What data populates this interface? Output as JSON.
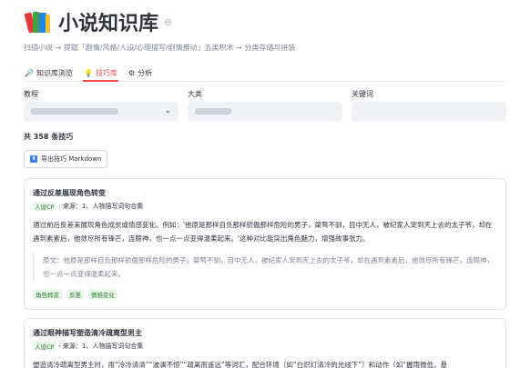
{
  "header": {
    "title": "小说知识库",
    "icon": "books-icon",
    "subtitle": "扫描小说 → 提取「剧情/风格/人设/心理描写/剧情推动」五类积木 → 分类存储与拼装"
  },
  "tabs": [
    {
      "label": "知识库浏览",
      "icon": "magnifier-icon",
      "active": false
    },
    {
      "label": "技巧库",
      "icon": "lightbulb-icon",
      "active": true
    },
    {
      "label": "分析",
      "icon": "gear-icon",
      "active": false
    }
  ],
  "filters": {
    "tutorial": {
      "label": "教程",
      "value_redacted": true
    },
    "category": {
      "label": "大类",
      "value_redacted": true
    },
    "keyword": {
      "label": "关键词",
      "value": ""
    }
  },
  "results": {
    "count_text": "共 358 条技巧",
    "export_label": "导出技巧 Markdown"
  },
  "cards": [
    {
      "title": "通过反差展现角色转变",
      "category": "人设CP",
      "source": "· 来源：1、人物描写词句合集",
      "body": "通过前后反差来展现角色成长或情感变化。例如：'他原是那样自负那样骄傲那样危险的男子，桀骜不驯，目中无人，被纪家人宠到天上去的太子爷，却在遇到素素后，他敛尽所有锋芒，连眼神，也一点一点变得温柔起来。'这种对比能突出角色魅力，增强故事张力。",
      "quote": "原文：他原是那样自负那样骄傲那样危险的男子。桀骜不驯，目中无人，被纪家人宠到天上去的太子爷，却在遇到素素后，他敛尽所有锋芒，连眼神，也一点一点变得温柔起来。",
      "tags": [
        "角色转变",
        "反差",
        "情感变化"
      ]
    },
    {
      "title": "通过眼神描写塑造清冷疏离型男主",
      "category": "人设CP",
      "source": "· 来源：1、人物描写词句合集",
      "body": "塑造清冷疏离型男主时，用“冷冷清清”“波澜不惊”“疏离而遥远”等词汇，配合环境（如“白炽灯清冷的光线下”）和动作（如“握雨微低，悬",
      "tags": []
    }
  ],
  "colors": {
    "accent": "#ff4b4b",
    "tag_green": "#2e7d32",
    "tag_bg": "#e8f5e9",
    "text": "#31333f",
    "muted": "#808495"
  }
}
